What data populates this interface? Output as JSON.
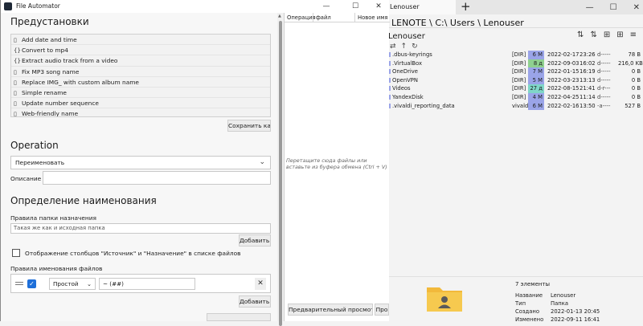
{
  "filemanager": {
    "tab_title": "Lenouser",
    "tab_add": "+",
    "win_min": "—",
    "win_max": "☐",
    "win_close": "✕",
    "path": "LENOTE \\ C:\\ Users \\ Lenouser",
    "current_folder": "Lenouser",
    "toolbar": [
      "⇅",
      "⇅",
      "⊞",
      "⊞",
      "≡"
    ],
    "nav": [
      "⇄",
      "↑",
      "↻"
    ],
    "files": [
      {
        "name": ".dbus-keyrings",
        "type": "[DIR]",
        "size": "6 M",
        "date": "2022-02-17",
        "time": "23:26",
        "attr": "d-----",
        "bytes": "78 B",
        "color": "#9aa4e8"
      },
      {
        "name": ".VirtualBox",
        "type": "[DIR]",
        "size": "8 д",
        "date": "2022-09-03",
        "time": "16:02",
        "attr": "d-----",
        "bytes": "216,0 KB",
        "color": "#8fd18f"
      },
      {
        "name": "OneDrive",
        "type": "[DIR]",
        "size": "7 M",
        "date": "2022-01-15",
        "time": "16:19",
        "attr": "d-----",
        "bytes": "0 B",
        "color": "#9aa4e8"
      },
      {
        "name": "OpenVPN",
        "type": "[DIR]",
        "size": "5 M",
        "date": "2022-03-23",
        "time": "13:13",
        "attr": "d-----",
        "bytes": "0 B",
        "color": "#9aa4e8"
      },
      {
        "name": "Videos",
        "type": "[DIR]",
        "size": "27 д",
        "date": "2022-08-15",
        "time": "21:41",
        "attr": "d-r---",
        "bytes": "0 B",
        "color": "#7fd6c8"
      },
      {
        "name": "YandexDisk",
        "type": "[DIR]",
        "size": "4 M",
        "date": "2022-04-25",
        "time": "11:14",
        "attr": "d-----",
        "bytes": "0 B",
        "color": "#9aa4e8"
      },
      {
        "name": ".vivaldi_reporting_data",
        "type": "vivald...",
        "size": "6 M",
        "date": "2022-02-16",
        "time": "13:50",
        "attr": "-a----",
        "bytes": "527 B",
        "color": "#9aa4e8"
      }
    ],
    "count": "7 элементы",
    "props": [
      {
        "k": "Название",
        "v": "Lenouser"
      },
      {
        "k": "Тип",
        "v": "Папка"
      },
      {
        "k": "Создано",
        "v": "2022-01-13  20:45"
      },
      {
        "k": "Изменено",
        "v": "2022-09-11  16:41"
      }
    ]
  },
  "app": {
    "title": "File Automator",
    "win_min": "—",
    "win_max": "☐",
    "win_close": "✕",
    "presets_heading": "Предустановки",
    "presets": [
      {
        "icon": "▯",
        "label": "Add date and time"
      },
      {
        "icon": "{}",
        "label": "Convert to mp4"
      },
      {
        "icon": "{}",
        "label": "Extract audio track from a video"
      },
      {
        "icon": "▯",
        "label": "Fix MP3 song name"
      },
      {
        "icon": "▯",
        "label": "Replace IMG_ with custom album name"
      },
      {
        "icon": "▯",
        "label": "Simple rename"
      },
      {
        "icon": "▯",
        "label": "Update number sequence"
      },
      {
        "icon": "▯",
        "label": "Web-friendly name"
      }
    ],
    "save_preset": "Сохранить как",
    "operation_heading": "Operation",
    "operation_value": "Переименовать",
    "description_label": "Описание",
    "naming_heading": "Определение наименования",
    "dest_rules_label": "Правила папки назначения",
    "dest_rules_placeholder": "Такая же как и исходная папка",
    "add_button_1": "Добавить г",
    "show_columns_label": "Отображение столбцов \"Источник\" и \"Назначение\" в списке файлов",
    "file_rules_label": "Правила именования файлов",
    "rule_type": "Простой",
    "rule_value": "~ (##)",
    "add_button_2": "Добавить г",
    "col_operation": "Операция",
    "col_file": "файл",
    "col_new_name": "Новое имя фа",
    "drop_hint": "Перетащите сюда файлы или вставьте из буфера обмена (Ctrl + V)",
    "preview_button": "Предварительный просмотр",
    "process_button": "Про"
  }
}
